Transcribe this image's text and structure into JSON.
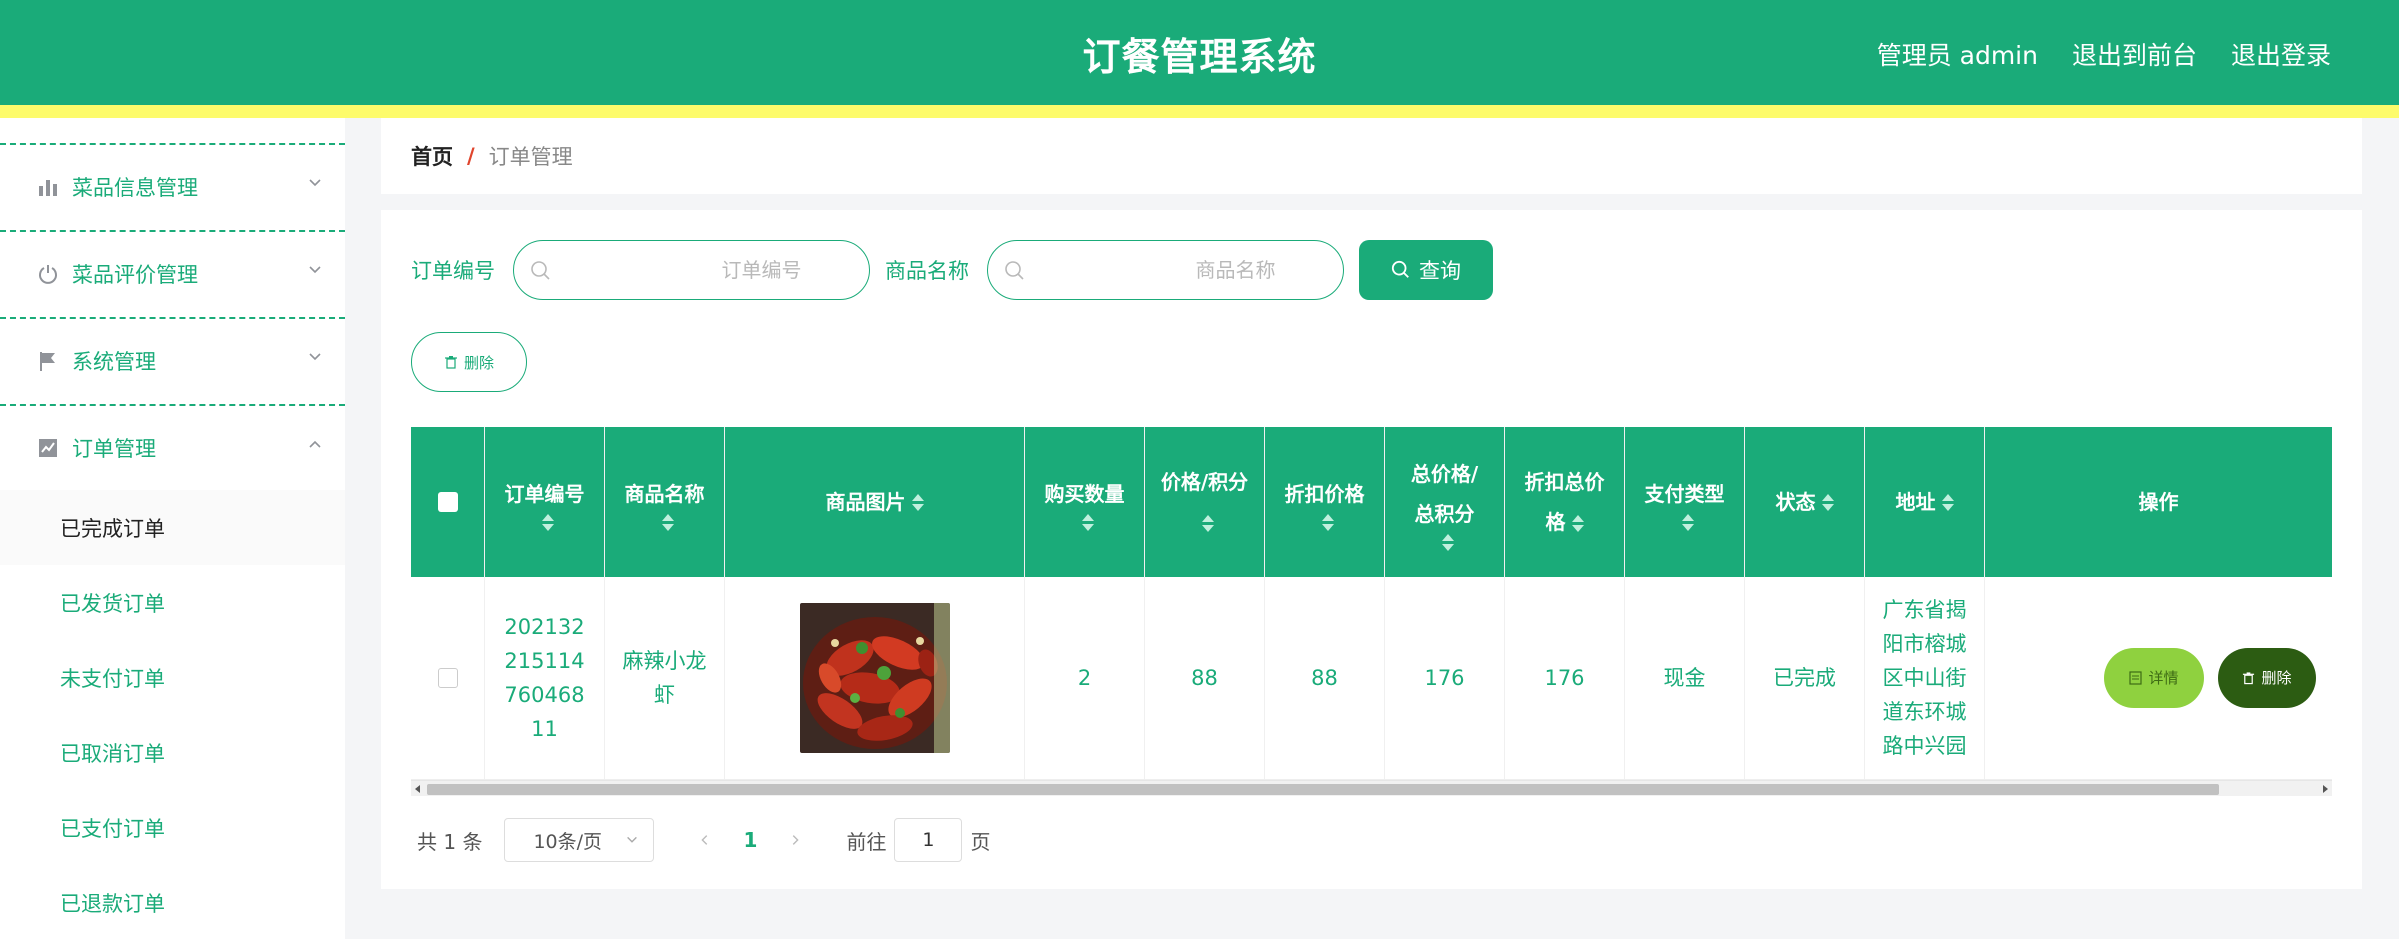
{
  "header": {
    "title": "订餐管理系统",
    "links": [
      "管理员 admin",
      "退出到前台",
      "退出登录"
    ]
  },
  "sidebar": {
    "menus": [
      {
        "label": "菜品信息管理",
        "icon": "bar-chart-icon"
      },
      {
        "label": "菜品评价管理",
        "icon": "power-icon"
      },
      {
        "label": "系统管理",
        "icon": "flag-icon"
      },
      {
        "label": "订单管理",
        "icon": "line-chart-icon",
        "expanded": true
      }
    ],
    "order_submenu": [
      "已完成订单",
      "已发货订单",
      "未支付订单",
      "已取消订单",
      "已支付订单",
      "已退款订单"
    ],
    "active_submenu": "已完成订单"
  },
  "breadcrumb": {
    "home": "首页",
    "separator": "/",
    "current": "订单管理"
  },
  "search": {
    "order_no_label": "订单编号",
    "order_no_placeholder": "订单编号",
    "goods_name_label": "商品名称",
    "goods_name_placeholder": "商品名称",
    "query_label": "查询"
  },
  "toolbar": {
    "delete_label": "删除"
  },
  "table": {
    "columns": [
      {
        "label": "订单编号",
        "sortable": true
      },
      {
        "label": "商品名称",
        "sortable": true
      },
      {
        "label": "商品图片",
        "sortable": true
      },
      {
        "label": "购买数量",
        "sortable": true
      },
      {
        "label": "价格/积分",
        "sortable": true
      },
      {
        "label": "折扣价格",
        "sortable": true
      },
      {
        "label": "总价格/总积分",
        "sortable": true
      },
      {
        "label": "折扣总价格",
        "sortable": true
      },
      {
        "label": "支付类型",
        "sortable": true
      },
      {
        "label": "状态",
        "sortable": true
      },
      {
        "label": "地址",
        "sortable": true
      },
      {
        "label": "操作",
        "sortable": false
      }
    ],
    "rows": [
      {
        "order_no": "20213221511476046811",
        "goods_name": "麻辣小龙虾",
        "image": "crayfish-photo",
        "quantity": "2",
        "price": "88",
        "discount_price": "88",
        "total": "176",
        "discount_total": "176",
        "pay_type": "现金",
        "status": "已完成",
        "address": "广东省揭阳市榕城区中山街道东环城路中兴园",
        "detail_label": "详情",
        "delete_label": "删除"
      }
    ]
  },
  "pager": {
    "total_text": "共 1 条",
    "page_size": "10条/页",
    "current_page": "1",
    "goto_label": "前往",
    "goto_value": "1",
    "page_suffix": "页"
  },
  "colors": {
    "primary": "#1aab79",
    "strip": "#fdfb6b",
    "detail": "#8fd13f",
    "delete": "#2c5c12"
  }
}
